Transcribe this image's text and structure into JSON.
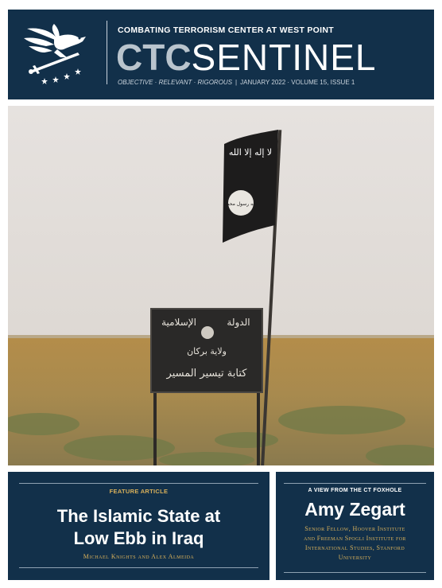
{
  "masthead": {
    "org_name": "COMBATING TERRORISM CENTER AT WEST POINT",
    "title_bold": "CTC",
    "title_light": "SENTINEL",
    "mottos": "OBJECTIVE · RELEVANT · RIGOROUS",
    "separator": "|",
    "issue_info": "JANUARY 2022 · VOLUME 15, ISSUE 1",
    "logo_icon": "eagle-sword-stars-icon"
  },
  "cover_photo": {
    "flag_text": "لا إله إلا الله",
    "seal_text": "الله رسول محمد",
    "sign_text_top_right": "الدولة",
    "sign_text_top_left": "الإسلامية",
    "sign_text_middle": "ولاية بركان",
    "sign_text_bottom": "كتابة تيسير المسير"
  },
  "feature": {
    "label": "FEATURE ARTICLE",
    "title_line1": "The Islamic State at",
    "title_line2": "Low Ebb in Iraq",
    "authors": "Michael Knights and Alex Almeida"
  },
  "foxhole": {
    "label": "A VIEW FROM THE CT FOXHOLE",
    "name": "Amy Zegart",
    "affiliation_line1": "Senior Fellow, Hoover Institute",
    "affiliation_line2": "and Freeman Spogli Institute for",
    "affiliation_line3": "International Studies, Stanford",
    "affiliation_line4": "University"
  },
  "colors": {
    "navy": "#12304a",
    "accent_gold": "#d8b05a",
    "light_steel": "#b9c4cd"
  }
}
